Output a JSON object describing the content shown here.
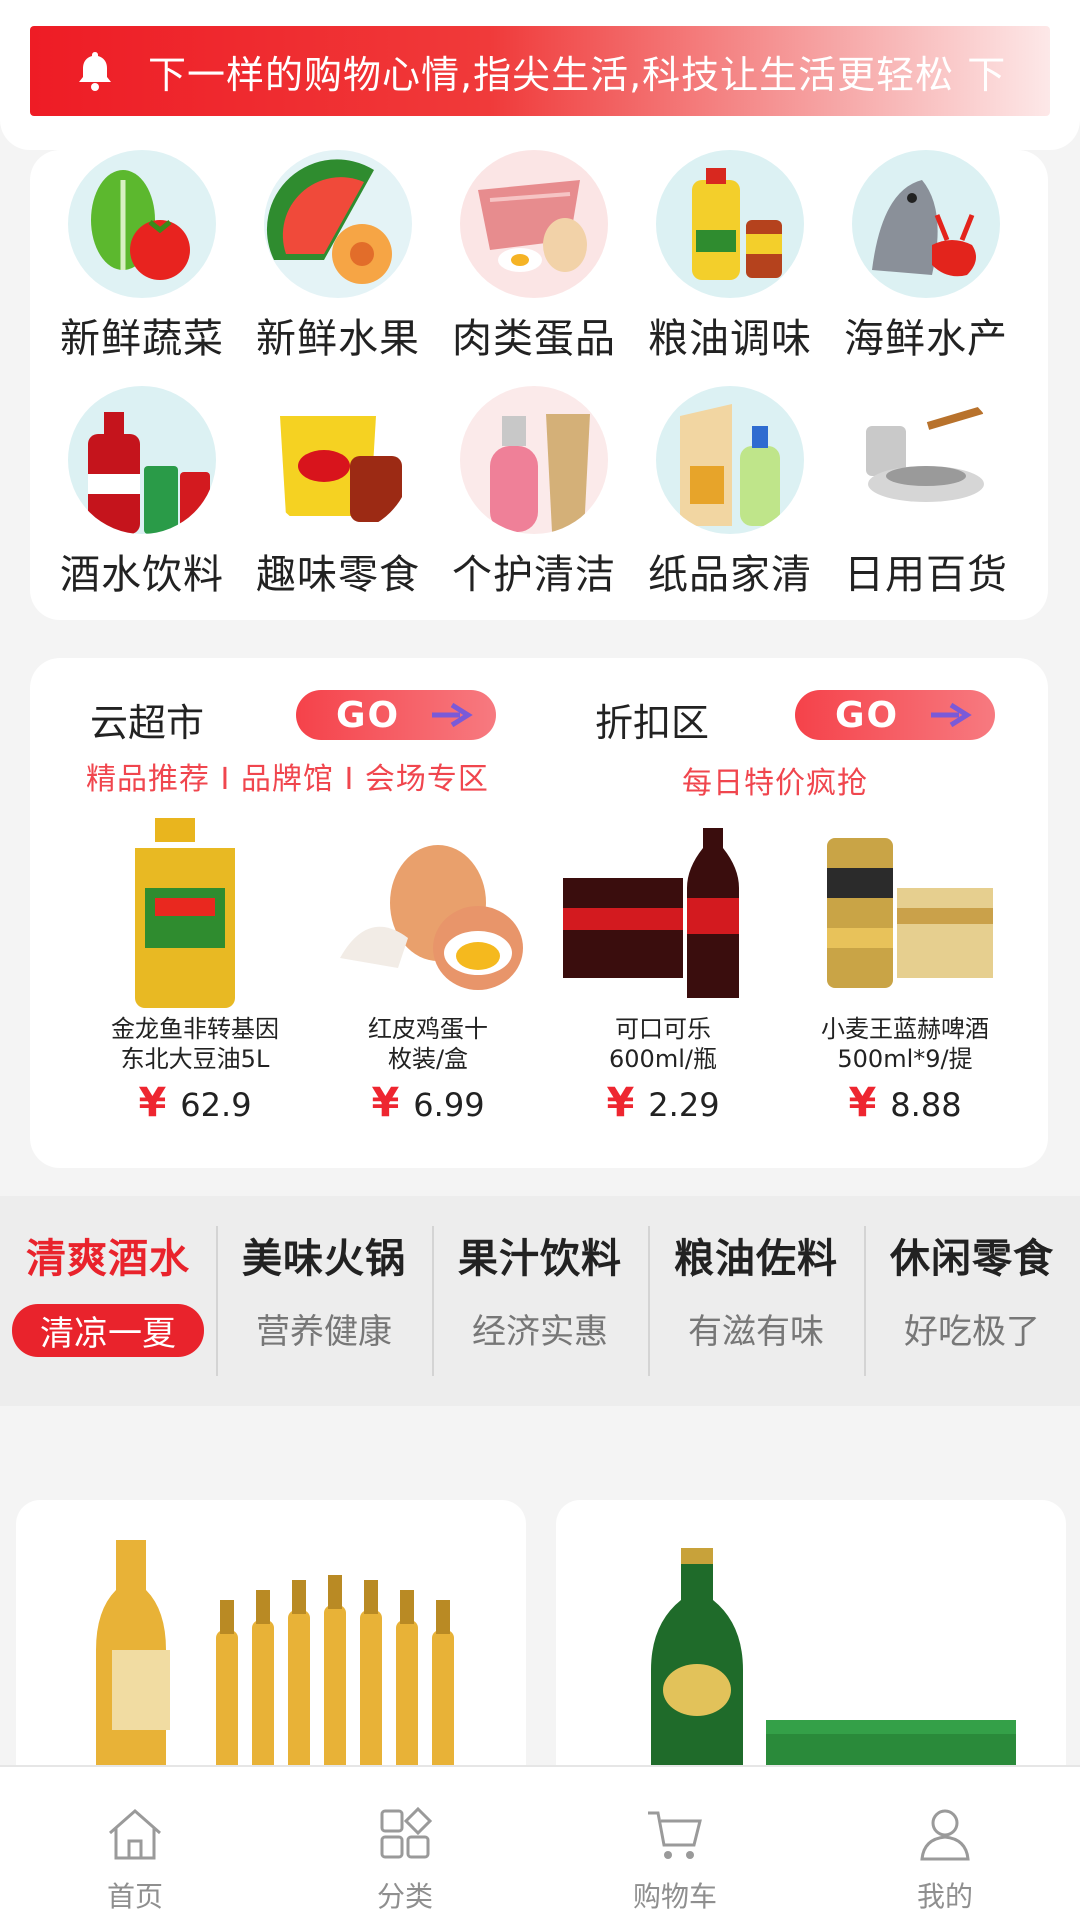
{
  "notice": {
    "text": "下一样的购物心情,指尖生活,科技让生活更轻松 下"
  },
  "categories": [
    {
      "label": "新鲜蔬菜",
      "icon": "vegetables-icon"
    },
    {
      "label": "新鲜水果",
      "icon": "fruits-icon"
    },
    {
      "label": "肉类蛋品",
      "icon": "meat-eggs-icon"
    },
    {
      "label": "粮油调味",
      "icon": "grain-oil-icon"
    },
    {
      "label": "海鲜水产",
      "icon": "seafood-icon"
    },
    {
      "label": "酒水饮料",
      "icon": "drinks-icon"
    },
    {
      "label": "趣味零食",
      "icon": "snacks-icon"
    },
    {
      "label": "个护清洁",
      "icon": "personal-care-icon"
    },
    {
      "label": "纸品家清",
      "icon": "paper-cleaning-icon"
    },
    {
      "label": "日用百货",
      "icon": "daily-goods-icon"
    }
  ],
  "promo": {
    "left": {
      "title": "云超市",
      "go": "GO",
      "sub": "精品推荐 I 品牌馆 I 会场专区"
    },
    "right": {
      "title": "折扣区",
      "go": "GO",
      "sub": "每日特价疯抢"
    },
    "products": [
      {
        "name1": "金龙鱼非转基因",
        "name2": "东北大豆油5L",
        "yen": "¥",
        "price": "62.9"
      },
      {
        "name1": "红皮鸡蛋十",
        "name2": "枚装/盒",
        "yen": "¥",
        "price": "6.99"
      },
      {
        "name1": "可口可乐",
        "name2": "600ml/瓶",
        "yen": "¥",
        "price": "2.29"
      },
      {
        "name1": "小麦王蓝赫啤酒",
        "name2": "500ml*9/提",
        "yen": "¥",
        "price": "8.88"
      }
    ]
  },
  "tabs": [
    {
      "title": "清爽酒水",
      "sub": "清凉一夏"
    },
    {
      "title": "美味火锅",
      "sub": "营养健康"
    },
    {
      "title": "果汁饮料",
      "sub": "经济实惠"
    },
    {
      "title": "粮油佐料",
      "sub": "有滋有味"
    },
    {
      "title": "休闲零食",
      "sub": "好吃极了"
    }
  ],
  "nav": [
    {
      "label": "首页",
      "icon": "home-icon"
    },
    {
      "label": "分类",
      "icon": "category-icon"
    },
    {
      "label": "购物车",
      "icon": "cart-icon"
    },
    {
      "label": "我的",
      "icon": "profile-icon"
    }
  ],
  "colors": {
    "accent": "#e9232c",
    "notice_start": "#ee1c25"
  }
}
